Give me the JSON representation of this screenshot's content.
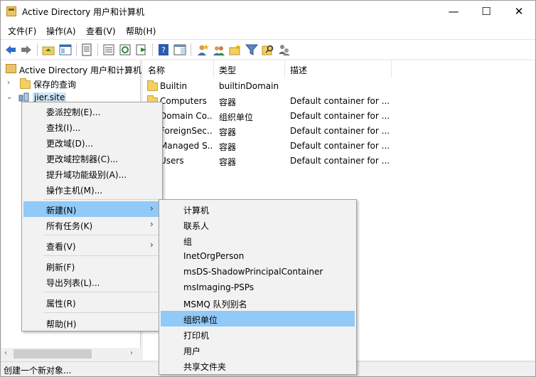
{
  "window": {
    "title": "Active Directory 用户和计算机",
    "minimize_glyph": "—",
    "maximize_glyph": "☐",
    "close_glyph": "✕"
  },
  "menubar": {
    "items": [
      "文件(F)",
      "操作(A)",
      "查看(V)",
      "帮助(H)"
    ]
  },
  "toolbar": {
    "icons": [
      "back-icon",
      "forward-icon",
      "folder-up-icon",
      "show-tree-icon",
      "export-list-icon",
      "properties-icon",
      "refresh-icon",
      "export-icon",
      "help-icon",
      "show-pane-icon",
      "new-user-icon",
      "new-group-icon",
      "new-ou-icon",
      "filter-icon",
      "find-icon",
      "delegate-icon"
    ]
  },
  "tree": {
    "root": "Active Directory 用户和计算机",
    "saved_queries": "保存的查询",
    "domain": "jier.site",
    "expand_glyph": "›",
    "collapse_glyph": "⌄"
  },
  "list": {
    "columns": [
      "名称",
      "类型",
      "描述"
    ],
    "rows": [
      {
        "name": "Builtin",
        "type": "builtinDomain",
        "description": ""
      },
      {
        "name": "Computers",
        "type": "容器",
        "description": "Default container for ..."
      },
      {
        "name": "Domain Co...",
        "type": "组织单位",
        "description": "Default container for ..."
      },
      {
        "name": "ForeignSec...",
        "type": "容器",
        "description": "Default container for ..."
      },
      {
        "name": "Managed S...",
        "type": "容器",
        "description": "Default container for ..."
      },
      {
        "name": "Users",
        "type": "容器",
        "description": "Default container for ..."
      }
    ]
  },
  "context_menu": {
    "groups": [
      [
        "委派控制(E)...",
        "查找(I)...",
        "更改域(D)...",
        "更改域控制器(C)...",
        "提升域功能级别(A)...",
        "操作主机(M)..."
      ],
      [
        "新建(N)",
        "所有任务(K)"
      ],
      [
        "查看(V)"
      ],
      [
        "刷新(F)",
        "导出列表(L)..."
      ],
      [
        "属性(R)"
      ],
      [
        "帮助(H)"
      ]
    ],
    "submenu_arrow": "›",
    "highlighted": "新建(N)"
  },
  "submenu": {
    "items": [
      "计算机",
      "联系人",
      "组",
      "InetOrgPerson",
      "msDS-ShadowPrincipalContainer",
      "msImaging-PSPs",
      "MSMQ 队列别名",
      "组织单位",
      "打印机",
      "用户",
      "共享文件夹"
    ],
    "highlighted": "组织单位"
  },
  "scrollbar": {
    "left_glyph": "‹",
    "right_glyph": "›"
  },
  "status": {
    "text": "创建一个新对象..."
  },
  "colors": {
    "highlight": "#91c9f7",
    "menu_bg": "#f2f2f2",
    "folder": "#f4cf62"
  }
}
